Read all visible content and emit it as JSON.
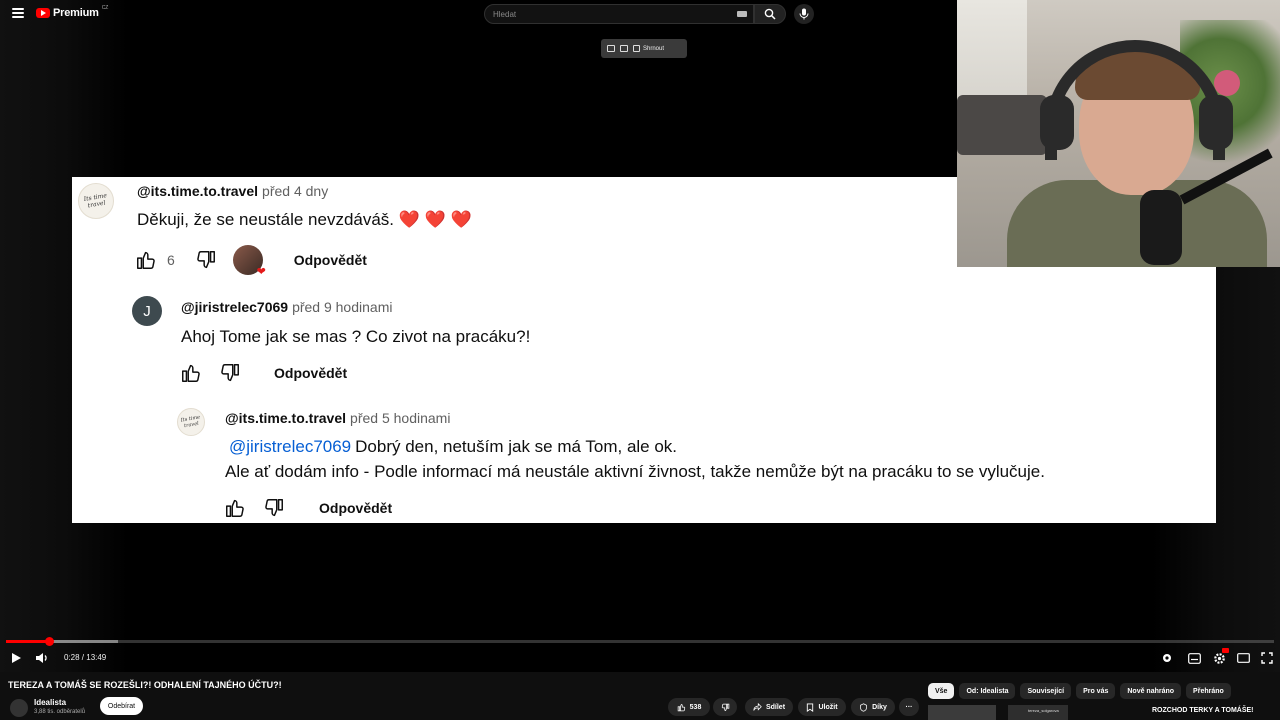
{
  "header": {
    "logo_text": "Premium",
    "logo_region": "CZ",
    "search_placeholder": "Hledat"
  },
  "overlay_toolbar": {
    "summarize_label": "Shrnout"
  },
  "comments": [
    {
      "author": "@its.time.to.travel",
      "time": "před 4 dny",
      "text": "Děkuji, že se neustále nevzdáváš. ❤️ ❤️ ❤️",
      "likes": "6",
      "reply_label": "Odpovědět",
      "avatar_text": "Its time travel"
    },
    {
      "author": "@jiristrelec7069",
      "time": "před 9 hodinami",
      "text": "Ahoj Tome jak se mas ? Co zivot na pracáku?!",
      "reply_label": "Odpovědět",
      "avatar_letter": "J"
    },
    {
      "author": "@its.time.to.travel",
      "time": "před 5 hodinami",
      "mention": "@jiristrelec7069",
      "text_line1": "Dobrý den, netuším jak se má Tom, ale ok.",
      "text_line2": "Ale ať dodám info - Podle informací má neustále aktivní živnost, takže nemůže být na pracáku to se vylučuje.",
      "reply_label": "Odpovědět",
      "avatar_text": "Its time travel"
    }
  ],
  "player": {
    "current_time": "0:28",
    "duration": "13:49",
    "time_display": "0:28 / 13:49",
    "played_fraction": 0.034,
    "accent_color": "#ff0000"
  },
  "video": {
    "title": "TEREZA A TOMÁŠ SE ROZEŠLI?! ODHALENÍ TAJNÉHO ÚČTU?!",
    "channel": "Idealista",
    "subscribers": "3,88 tis. odběratelů",
    "subscribe_label": "Odebírat",
    "like_count": "538",
    "share_label": "Sdílet",
    "save_label": "Uložit",
    "thanks_label": "Díky",
    "more_label": "···"
  },
  "chips": [
    "Vše",
    "Od: Idealista",
    "Související",
    "Pro vás",
    "Nově nahráno",
    "Přehráno"
  ],
  "recommendation": {
    "channel_label": "tereza_solgarova",
    "title": "ROZCHOD TERKY A TOMÁŠE!"
  }
}
